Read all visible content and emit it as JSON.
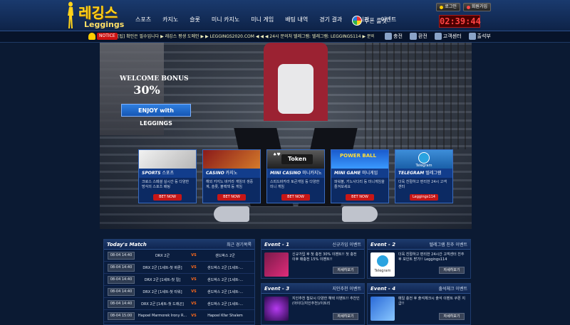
{
  "brand": {
    "name_kr": "레깅스",
    "name_en": "Leggings"
  },
  "nav": [
    "스포츠",
    "카지노",
    "슬롯",
    "미니 카지노",
    "미니 게임",
    "배팅 내역",
    "경기 결과",
    "게시판",
    "이벤트"
  ],
  "roulette": {
    "label": "쿠폰 룰렛"
  },
  "top_buttons": {
    "login": "로그인",
    "register": "회원가입"
  },
  "clock": "02:39:44",
  "notice": {
    "tag": "NOTICE",
    "text": "[팁] 확인은 필수입니다 ▶ 레깅스 평생 도메인 ▶ ▶ LEGGINGS2020.COM ◀ ◀ ◀ 24시 문의처 텔레그램: 텔레그램: LEGGINGS114 ▶ 문의하실때 말씀 해주시면 빠른 처리"
  },
  "quick": [
    "충전",
    "환전",
    "고객센터",
    "출석부"
  ],
  "hero": {
    "welcome_line1": "WELCOME BONUS",
    "welcome_line2": "30%",
    "enjoy_button": "ENJOY with LEGGINGS"
  },
  "cards": [
    {
      "title_en": "SPORTS",
      "title_kr": "스포츠",
      "desc": "크로스 스페셜 실시간 등 다양한 방식의 스포츠 배팅",
      "bet": "BET NOW"
    },
    {
      "title_en": "CASINO",
      "title_kr": "카지노",
      "desc": "해외 카지노 바카라 게임의 생중계, 슬롯, 블랙잭 등 게임",
      "bet": "BET NOW"
    },
    {
      "title_en": "MINI CASINO",
      "title_kr": "미니카지노",
      "desc": "스피드바카라 토큰게임 등 다양한 미니 게임",
      "bet": "BET NOW",
      "token": "Token"
    },
    {
      "title_en": "MINI GAME",
      "title_kr": "미니게임",
      "desc": "파워볼, 키노사다리 등 미니게임을 즐겨보세요",
      "bet": "BET NOW",
      "powerball": "POWER BALL"
    },
    {
      "title_en": "TELEGRAM",
      "title_kr": "텔레그램",
      "desc": "더욱 친절하고 편리한 24시 고객센터",
      "bet": "Leggings114",
      "tele_label": "Telegram"
    }
  ],
  "match_panel": {
    "title": "Today's Match",
    "right": "최근 경기목록",
    "vs": "VS",
    "rows": [
      {
        "time": "08-04 14:40",
        "home": "DRX 2군",
        "away": "샌드박스 2군"
      },
      {
        "time": "08-04 14:40",
        "home": "DRX 2군 [1세트-첫 바론]",
        "away": "샌드박스 2군 [1세트-..."
      },
      {
        "time": "08-04 14:40",
        "home": "DRX 2군 [1세트-첫 킬]",
        "away": "샌드박스 2군 [1세트-..."
      },
      {
        "time": "08-04 14:40",
        "home": "DRX 2군 [1세트-첫 타워]",
        "away": "샌드박스 2군 [1세트-..."
      },
      {
        "time": "08-04 14:40",
        "home": "DRX 2군 [1세트-첫 드래곤]",
        "away": "샌드박스 2군 [1세트-..."
      },
      {
        "time": "08-04 15:00",
        "home": "Hapoel Marmorek Irony R...",
        "away": "Hapoel Kfar Shalem"
      }
    ]
  },
  "events": [
    {
      "title": "Event - 1",
      "right": "신규가입 이벤트",
      "text": "신규가입 후 첫 충전 30% 이벤트!! 첫 충전 이후 매충전 15% 이벤트!!",
      "button": "자세히보기"
    },
    {
      "title": "Event - 2",
      "right": "텔레그램 친추 이벤트",
      "text": "더욱 친절하고 편리한 24시간 고객센터 친추후 포인트 받기!! Leggings114",
      "button": "자세히보기",
      "img_label": "Telegram"
    },
    {
      "title": "Event - 3",
      "right": "지인추천 이벤트",
      "text": "지인추천 첩보시 다양한 혜택 이벤트!! 추천인(아이디/지인추천)/이트리",
      "button": "자세히보기"
    },
    {
      "title": "Event - 4",
      "right": "출석체크 이벤트",
      "text": "매일 충전 후 출석체크시 출석 이벤트 쿠폰 지급!!",
      "button": "자세히보기"
    }
  ]
}
